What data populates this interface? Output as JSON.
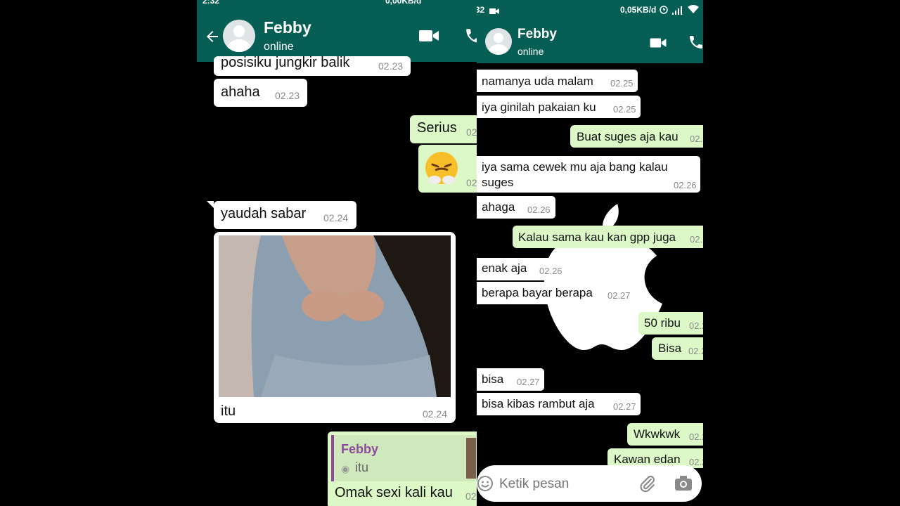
{
  "left": {
    "status_time": "2:32",
    "status_net": "0,00KB/d",
    "contact_name": "Febby",
    "contact_status": "online",
    "messages": [
      {
        "text": "posisiku jungkir  balik",
        "time": "02.23"
      },
      {
        "text": "ahaha",
        "time": "02.23"
      },
      {
        "text": "Serius",
        "time": "02"
      },
      {
        "text": "😤",
        "time": "02"
      },
      {
        "text": "yaudah sabar",
        "time": "02.24"
      },
      {
        "text": "itu",
        "time": "02.24"
      },
      {
        "quote_name": "Febby",
        "quote_text": "itu",
        "text": "Omak sexi kali kau",
        "time": "02"
      }
    ]
  },
  "right": {
    "status_time": "32",
    "status_net": "0,05KB/d",
    "contact_name": "Febby",
    "contact_status": "online",
    "messages": [
      {
        "text": "namanya uda malam",
        "time": "02.25"
      },
      {
        "text": "iya ginilah pakaian ku",
        "time": "02.25"
      },
      {
        "text": "Buat suges aja kau",
        "time": "02.2"
      },
      {
        "text": "iya sama cewek mu aja bang kalau",
        "text2": "suges",
        "time": "02.26"
      },
      {
        "text": "ahaga",
        "time": "02.26"
      },
      {
        "text": "Kalau sama kau kan gpp juga",
        "time": "02.2"
      },
      {
        "text": "enak aja",
        "time": "02.26"
      },
      {
        "text": "berapa bayar berapa",
        "time": "02.27"
      },
      {
        "text": "50 ribu",
        "time": "02.2"
      },
      {
        "text": "Bisa",
        "time": "02.2"
      },
      {
        "text": "bisa",
        "time": "02.27"
      },
      {
        "text": "bisa kibas rambut aja",
        "time": "02.27"
      },
      {
        "text": "Wkwkwk",
        "time": "02.2"
      },
      {
        "text": "Kawan edan",
        "time": "02.2"
      }
    ],
    "input_placeholder": "Ketik pesan"
  },
  "colors": {
    "header": "#075e54",
    "incoming": "#ffffff",
    "outgoing": "#dcf8c6",
    "quote_bar": "#8e4a9c"
  }
}
